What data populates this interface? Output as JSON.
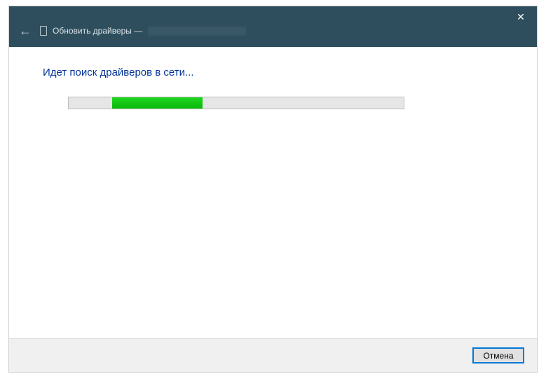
{
  "titlebar": {
    "back_icon": "←",
    "title_prefix": "Обновить драйверы —",
    "close_icon": "✕"
  },
  "content": {
    "status_heading": "Идет поиск драйверов в сети...",
    "progress": {
      "chunk_left_pct": 13,
      "chunk_width_pct": 27
    }
  },
  "footer": {
    "cancel_label": "Отмена"
  }
}
